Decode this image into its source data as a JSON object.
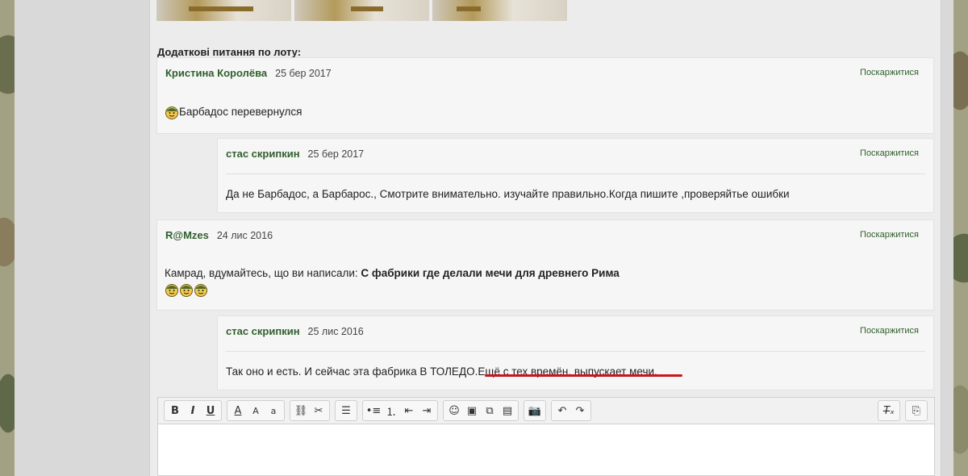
{
  "section_title": "Додаткові питання по лоту:",
  "report_label": "Поскаржитися",
  "comments": [
    {
      "author": "Кристина Королёва",
      "date": "25 бер 2017",
      "text": "Барбадос перевернулся"
    },
    {
      "author": "стас скрипкин",
      "date": "25 бер 2017",
      "text": "Да не Барбадос, а Барбарос., Смотрите внимательно. изучайте правильно.Когда пишите ,проверяйтье ошибки"
    },
    {
      "author": "R@Mzes",
      "date": "24 лис 2016",
      "text_prefix": "Камрад, вдумайтесь, що ви написали: ",
      "text_bold": "С фабрики где делали мечи для древнего Рима"
    },
    {
      "author": "стас скрипкин",
      "date": "25 лис 2016",
      "text": "Так оно и есть. И сейчас эта фабрика В ТОЛЕДО.Ещё с тех времён. выпускает мечи."
    }
  ],
  "toolbar": {
    "bold": "B",
    "italic": "I",
    "underline": "U",
    "text_color": "A",
    "font_size": "A",
    "small_caps": "a"
  },
  "icons": {
    "smiley": "soldier-smiley-icon",
    "link": "link-icon",
    "unlink": "unlink-icon",
    "align": "align-left-icon",
    "bullet": "bulleted-list-icon",
    "numbered": "numbered-list-icon",
    "outdent": "outdent-icon",
    "indent": "indent-icon",
    "emoji": "emoji-icon",
    "image": "image-icon",
    "gallery": "gallery-icon",
    "page": "page-break-icon",
    "camera": "camera-icon",
    "undo": "undo-icon",
    "redo": "redo-icon",
    "clear_format": "clear-format-icon",
    "source": "source-icon"
  },
  "colors": {
    "author": "#2f5f2c",
    "highlight": "#c8161d"
  }
}
